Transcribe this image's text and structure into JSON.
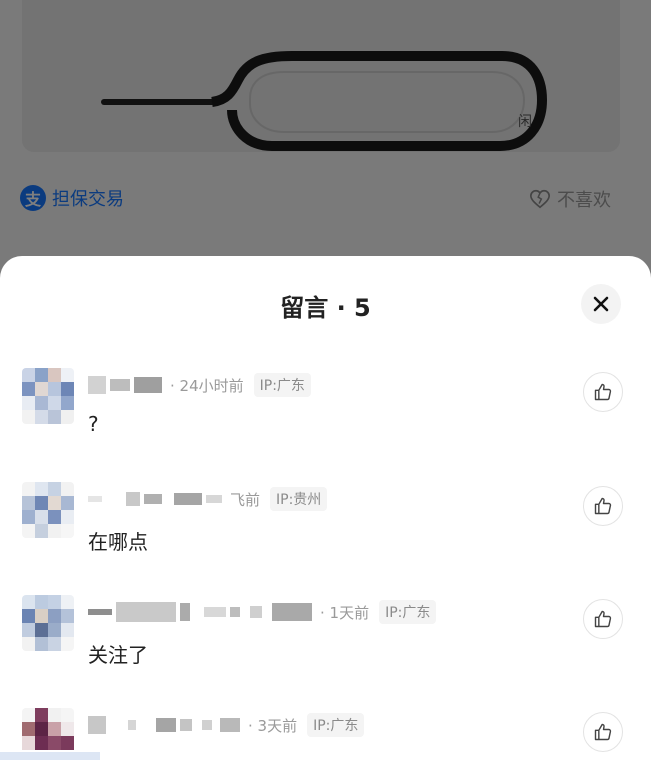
{
  "background": {
    "guarantee_label": "担保交易",
    "guarantee_icon": "alipay-icon",
    "watermark": "闲",
    "dislike_label": "不喜欢",
    "dislike_icon": "broken-heart-icon"
  },
  "sheet": {
    "title": "留言 · 5",
    "close_icon": "close-icon"
  },
  "comments": [
    {
      "time": "· 24小时前",
      "ip": "IP:广东",
      "text": "?",
      "like_icon": "thumbs-up-icon"
    },
    {
      "time": "飞前",
      "ip": "IP:贵州",
      "text": "在哪点",
      "like_icon": "thumbs-up-icon"
    },
    {
      "time": "· 1天前",
      "ip": "IP:广东",
      "text": "关注了",
      "like_icon": "thumbs-up-icon"
    },
    {
      "time": "· 3天前",
      "ip": "IP:广东",
      "text": "",
      "like_icon": "thumbs-up-icon"
    }
  ],
  "colors": {
    "accent_blue": "#1677ff",
    "text_primary": "#222222",
    "text_secondary": "#9a9a9a"
  }
}
